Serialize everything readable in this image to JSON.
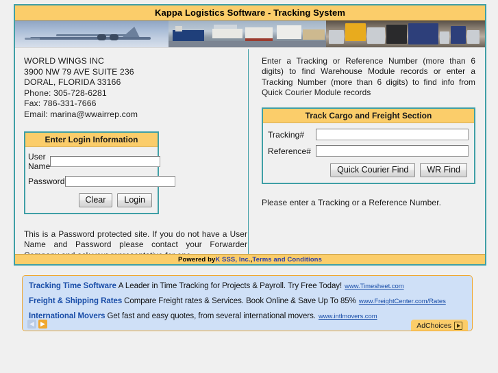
{
  "window": {
    "title": "Kappa Logistics Software - Tracking System"
  },
  "banner": {
    "images": [
      "airplane-photo",
      "ships-port-photo",
      "trucks-photo"
    ]
  },
  "company": {
    "name": "WORLD WINGS INC",
    "street": "3900 NW 79 AVE SUITE 236",
    "city_state_zip": "DORAL, FLORIDA 33166",
    "phone": "Phone: 305-728-6281",
    "fax": "Fax: 786-331-7666",
    "email": "Email: marina@wwairrep.com"
  },
  "login": {
    "heading": "Enter Login Information",
    "username_label": "User Name",
    "username_value": "",
    "password_label": "Password",
    "password_value": "",
    "clear_label": "Clear",
    "login_label": "Login"
  },
  "left_note": "This is a Password protected site. If you do not have a User Name and Password please contact your Forwarder Company and ask your representative for one.",
  "tracking": {
    "intro": "Enter a Tracking or Reference Number (more than 6 digits) to find Warehouse Module records or enter a Tracking Number (more than 6 digits) to find info from Quick Courier Module records",
    "heading": "Track Cargo and Freight Section",
    "tracking_label": "Tracking#",
    "tracking_value": "",
    "reference_label": "Reference#",
    "reference_value": "",
    "quick_courier_label": "Quick Courier Find",
    "wr_find_label": "WR Find",
    "message": "Please enter a Tracking or a Reference Number."
  },
  "footer": {
    "powered_by": "Powered by ",
    "link_company": "K SSS, Inc.",
    "separator": ", ",
    "link_terms": "Terms and Conditions"
  },
  "ads": {
    "items": [
      {
        "title": "Tracking Time Software",
        "text": "A Leader in Time Tracking for Projects & Payroll. Try Free Today!",
        "url": "www.Timesheet.com"
      },
      {
        "title": "Freight & Shipping Rates",
        "text": "Compare Freight rates & Services. Book Online & Save Up To 85%",
        "url": "www.FreightCenter.com/Rates"
      },
      {
        "title": "International Movers",
        "text": "Get fast and easy quotes, from several international movers.",
        "url": "www.intlmovers.com"
      }
    ],
    "prev_label": "◀",
    "next_label": "▶",
    "adchoices_label": "AdChoices"
  },
  "colors": {
    "accent_orange": "#fbcd6a",
    "accent_teal": "#3f9fa6",
    "link_blue": "#1a4ea8",
    "ad_background": "#cfe0f7",
    "page_background": "#f0f0f0"
  }
}
